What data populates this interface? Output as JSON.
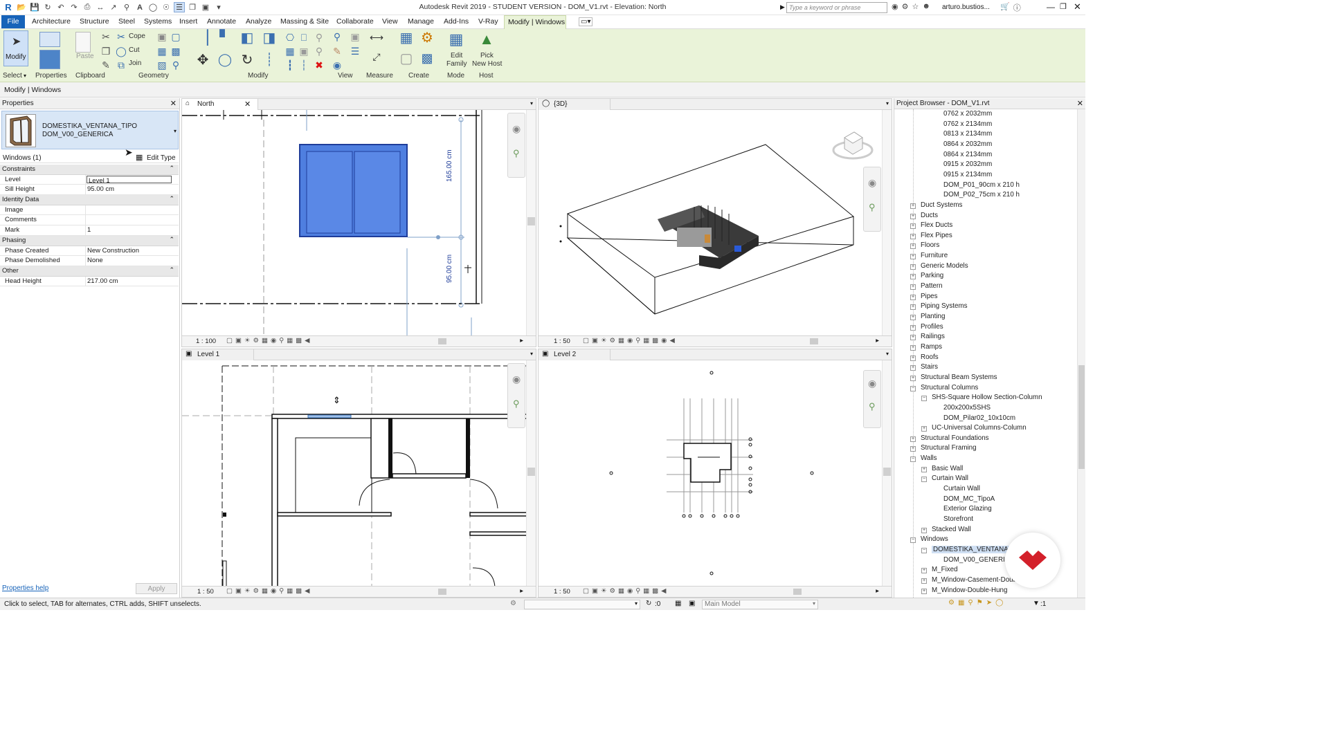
{
  "app": {
    "title": "Autodesk Revit 2019 - STUDENT VERSION - DOM_V1.rvt - Elevation: North",
    "search_placeholder": "Type a keyword or phrase",
    "user": "arturo.bustios...",
    "accent": "#1763b9",
    "ribbon_color": "#eaf3d9"
  },
  "menu": {
    "file": "File",
    "tabs": [
      "Architecture",
      "Structure",
      "Steel",
      "Systems",
      "Insert",
      "Annotate",
      "Analyze",
      "Massing & Site",
      "Collaborate",
      "View",
      "Manage",
      "Add-Ins",
      "V-Ray"
    ],
    "active": "Modify | Windows"
  },
  "ribbon": {
    "modify": "Modify",
    "properties": "Properties",
    "paste": "Paste",
    "cope": "Cope",
    "cut": "Cut",
    "join": "Join",
    "edit_family_1": "Edit",
    "edit_family_2": "Family",
    "pick_host_1": "Pick",
    "pick_host_2": "New Host",
    "groups": {
      "select": "Select",
      "properties": "Properties",
      "clipboard": "Clipboard",
      "geometry": "Geometry",
      "modify": "Modify",
      "view": "View",
      "measure": "Measure",
      "create": "Create",
      "mode": "Mode",
      "host": "Host"
    }
  },
  "context_bar": "Modify | Windows",
  "properties": {
    "title": "Properties",
    "type_line1": "DOMESTIKA_VENTANA_TIPO",
    "type_line2": "DOM_V00_GENERICA",
    "filter": "Windows (1)",
    "edit_type": "Edit Type",
    "sections": [
      {
        "name": "Constraints",
        "rows": [
          [
            "Level",
            "Level 1"
          ],
          [
            "Sill Height",
            "95.00 cm"
          ]
        ]
      },
      {
        "name": "Identity Data",
        "rows": [
          [
            "Image",
            ""
          ],
          [
            "Comments",
            ""
          ],
          [
            "Mark",
            "1"
          ]
        ]
      },
      {
        "name": "Phasing",
        "rows": [
          [
            "Phase Created",
            "New Construction"
          ],
          [
            "Phase Demolished",
            "None"
          ]
        ]
      },
      {
        "name": "Other",
        "rows": [
          [
            "Head Height",
            "217.00 cm"
          ]
        ]
      }
    ],
    "help": "Properties help",
    "apply": "Apply"
  },
  "views": {
    "north": {
      "title": "North",
      "scale": "1 : 100",
      "dim1": "165.00 cm",
      "dim2": "95.00 cm"
    },
    "threed": {
      "title": "{3D}",
      "scale": "1 : 50"
    },
    "level1": {
      "title": "Level 1",
      "scale": "1 : 50"
    },
    "level2": {
      "title": "Level 2",
      "scale": "1 : 50"
    }
  },
  "browser": {
    "title": "Project Browser - DOM_V1.rvt",
    "items": [
      {
        "label": "0762 x 2032mm",
        "level": 3,
        "toggle": ""
      },
      {
        "label": "0762 x 2134mm",
        "level": 3,
        "toggle": ""
      },
      {
        "label": "0813 x 2134mm",
        "level": 3,
        "toggle": ""
      },
      {
        "label": "0864 x 2032mm",
        "level": 3,
        "toggle": ""
      },
      {
        "label": "0864 x 2134mm",
        "level": 3,
        "toggle": ""
      },
      {
        "label": "0915 x 2032mm",
        "level": 3,
        "toggle": ""
      },
      {
        "label": "0915 x 2134mm",
        "level": 3,
        "toggle": ""
      },
      {
        "label": "DOM_P01_90cm x 210 h",
        "level": 3,
        "toggle": ""
      },
      {
        "label": "DOM_P02_75cm x 210 h",
        "level": 3,
        "toggle": ""
      },
      {
        "label": "Duct Systems",
        "level": 1,
        "toggle": "+"
      },
      {
        "label": "Ducts",
        "level": 1,
        "toggle": "+"
      },
      {
        "label": "Flex Ducts",
        "level": 1,
        "toggle": "+"
      },
      {
        "label": "Flex Pipes",
        "level": 1,
        "toggle": "+"
      },
      {
        "label": "Floors",
        "level": 1,
        "toggle": "+"
      },
      {
        "label": "Furniture",
        "level": 1,
        "toggle": "+"
      },
      {
        "label": "Generic Models",
        "level": 1,
        "toggle": "+"
      },
      {
        "label": "Parking",
        "level": 1,
        "toggle": "+"
      },
      {
        "label": "Pattern",
        "level": 1,
        "toggle": "+"
      },
      {
        "label": "Pipes",
        "level": 1,
        "toggle": "+"
      },
      {
        "label": "Piping Systems",
        "level": 1,
        "toggle": "+"
      },
      {
        "label": "Planting",
        "level": 1,
        "toggle": "+"
      },
      {
        "label": "Profiles",
        "level": 1,
        "toggle": "+"
      },
      {
        "label": "Railings",
        "level": 1,
        "toggle": "+"
      },
      {
        "label": "Ramps",
        "level": 1,
        "toggle": "+"
      },
      {
        "label": "Roofs",
        "level": 1,
        "toggle": "+"
      },
      {
        "label": "Stairs",
        "level": 1,
        "toggle": "+"
      },
      {
        "label": "Structural Beam Systems",
        "level": 1,
        "toggle": "+"
      },
      {
        "label": "Structural Columns",
        "level": 1,
        "toggle": "-"
      },
      {
        "label": "SHS-Square Hollow Section-Column",
        "level": 2,
        "toggle": "-"
      },
      {
        "label": "200x200x5SHS",
        "level": 3,
        "toggle": ""
      },
      {
        "label": "DOM_Pilar02_10x10cm",
        "level": 3,
        "toggle": ""
      },
      {
        "label": "UC-Universal Columns-Column",
        "level": 2,
        "toggle": "+"
      },
      {
        "label": "Structural Foundations",
        "level": 1,
        "toggle": "+"
      },
      {
        "label": "Structural Framing",
        "level": 1,
        "toggle": "+"
      },
      {
        "label": "Walls",
        "level": 1,
        "toggle": "-"
      },
      {
        "label": "Basic Wall",
        "level": 2,
        "toggle": "+"
      },
      {
        "label": "Curtain Wall",
        "level": 2,
        "toggle": "-"
      },
      {
        "label": "Curtain Wall",
        "level": 3,
        "toggle": ""
      },
      {
        "label": "DOM_MC_TipoA",
        "level": 3,
        "toggle": ""
      },
      {
        "label": "Exterior Glazing",
        "level": 3,
        "toggle": ""
      },
      {
        "label": "Storefront",
        "level": 3,
        "toggle": ""
      },
      {
        "label": "Stacked Wall",
        "level": 2,
        "toggle": "+"
      },
      {
        "label": "Windows",
        "level": 1,
        "toggle": "-"
      },
      {
        "label": "DOMESTIKA_VENTANA_T",
        "level": 2,
        "toggle": "-",
        "selected": true
      },
      {
        "label": "DOM_V00_GENERICA",
        "level": 3,
        "toggle": ""
      },
      {
        "label": "M_Fixed",
        "level": 2,
        "toggle": "+"
      },
      {
        "label": "M_Window-Casement-Doub...",
        "level": 2,
        "toggle": "+"
      },
      {
        "label": "M_Window-Double-Hung",
        "level": 2,
        "toggle": "+"
      }
    ]
  },
  "status": {
    "hint": "Click to select, TAB for alternates, CTRL adds, SHIFT unselects.",
    "zero": ":0",
    "model": "Main Model",
    "filter_count": ":1"
  }
}
